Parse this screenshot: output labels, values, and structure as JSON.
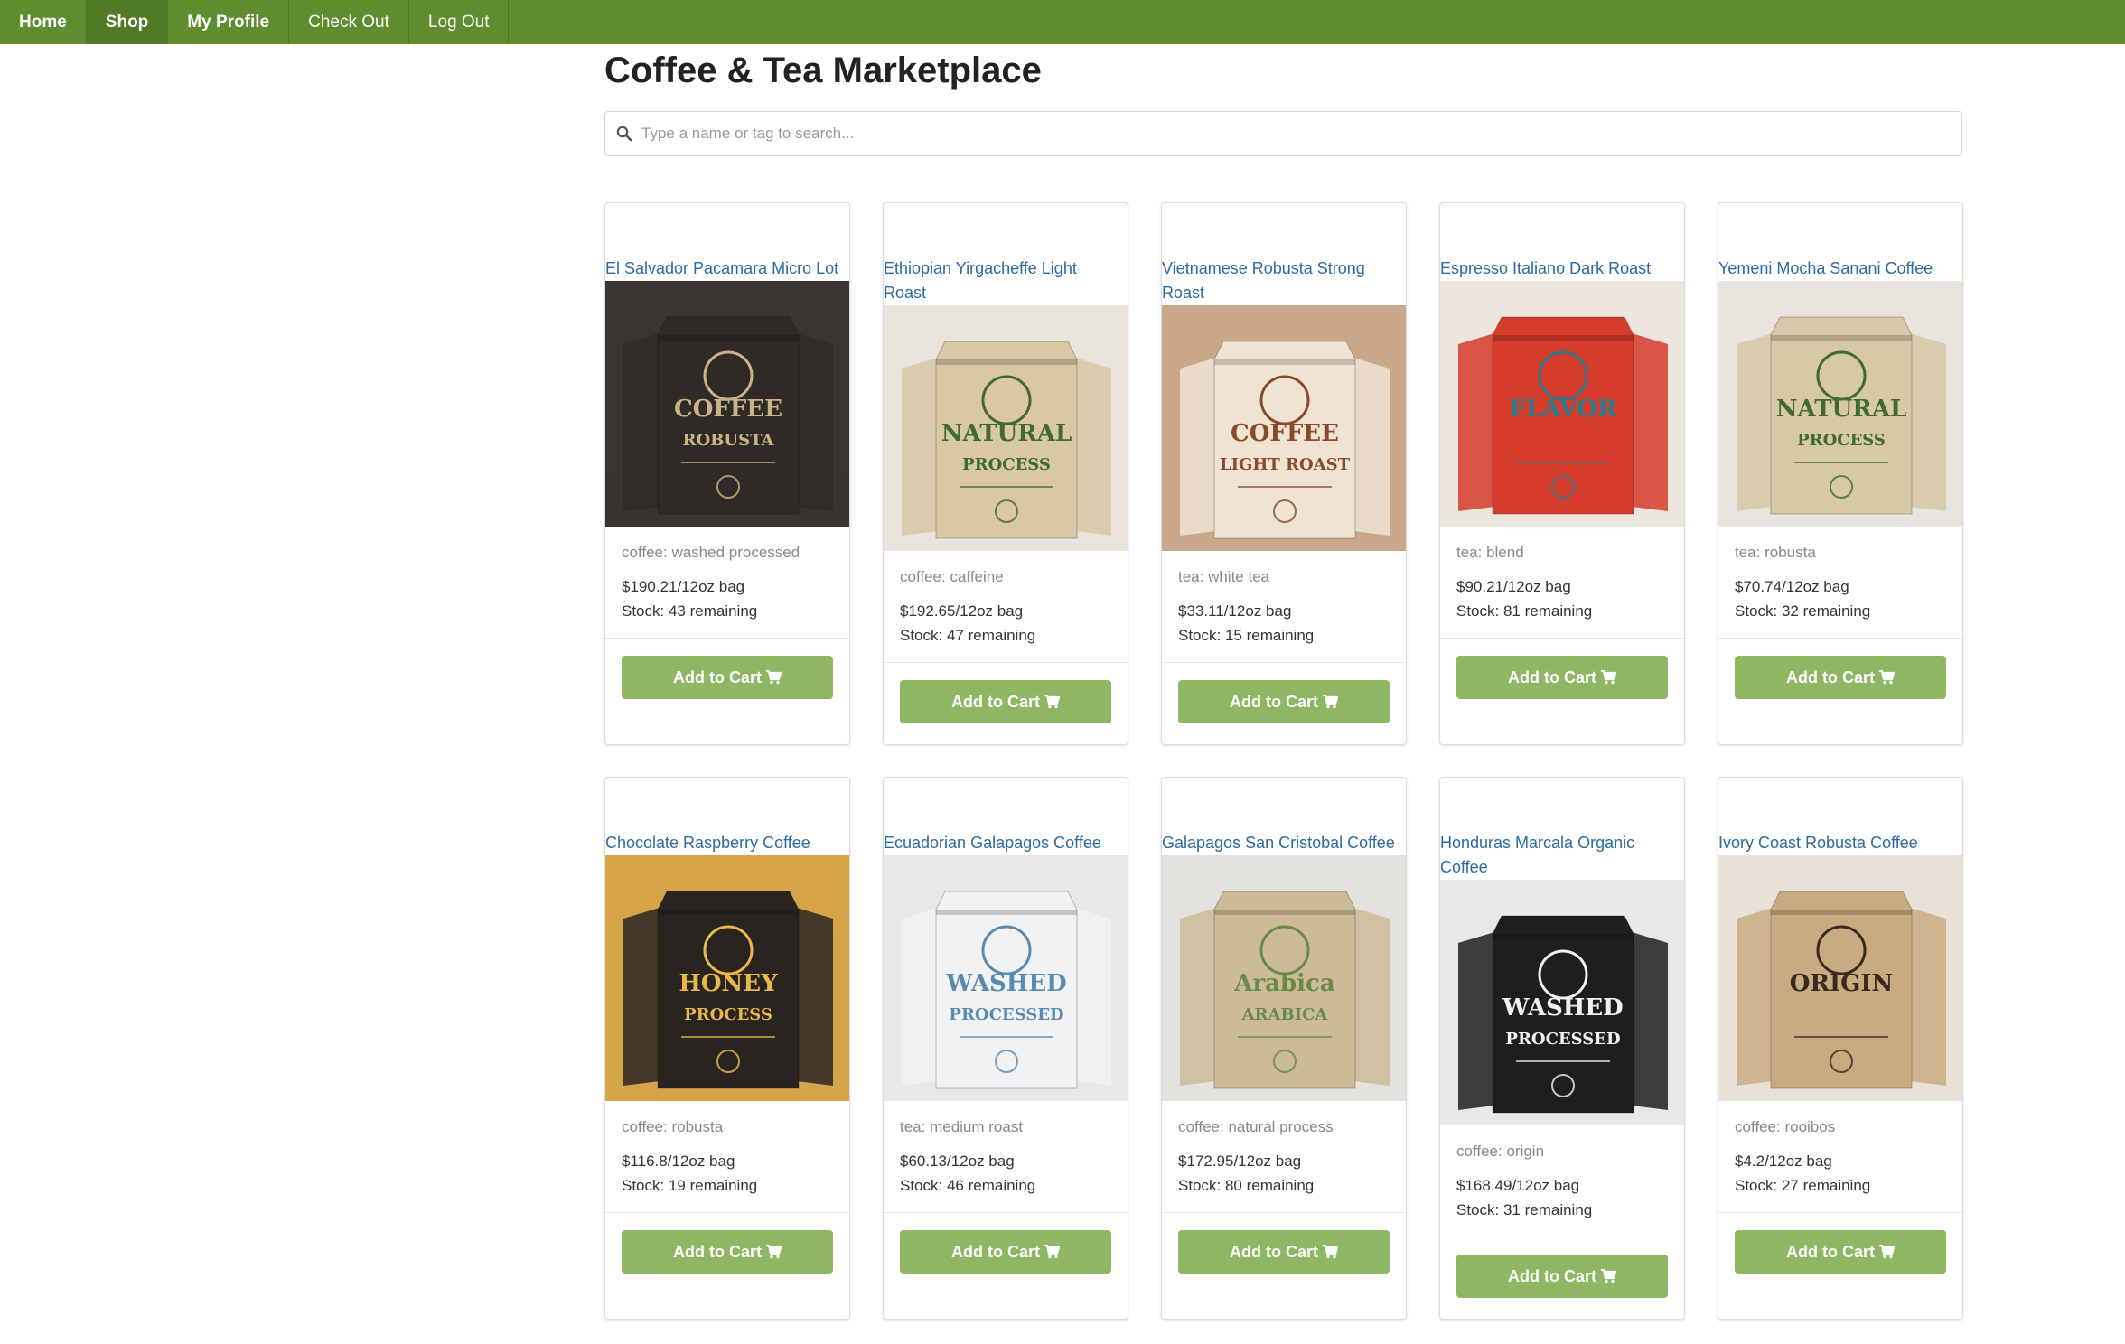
{
  "nav": [
    {
      "label": "Home",
      "name": "nav-home"
    },
    {
      "label": "Shop",
      "name": "nav-shop"
    },
    {
      "label": "My Profile",
      "name": "nav-my-profile"
    },
    {
      "label": "Check Out",
      "name": "nav-check-out"
    },
    {
      "label": "Log Out",
      "name": "nav-log-out"
    }
  ],
  "page": {
    "title": "Coffee & Tea Marketplace"
  },
  "search": {
    "placeholder": "Type a name or tag to search..."
  },
  "add_to_cart_label": "Add to Cart",
  "products": [
    {
      "title": "El Salvador Pacamara Micro Lot",
      "tag": "coffee: washed processed",
      "price": "$190.21/12oz bag",
      "stock": "Stock: 43 remaining",
      "art": {
        "bg": "#3a3530",
        "bag": "#2f2a26",
        "accent": "#c9b48a",
        "words": [
          "COFFEE",
          "ROBUSTA"
        ]
      }
    },
    {
      "title": "Ethiopian Yirgacheffe Light Roast",
      "tag": "coffee: caffeine",
      "price": "$192.65/12oz bag",
      "stock": "Stock: 47 remaining",
      "art": {
        "bg": "#e9e5dc",
        "bag": "#d9c7a6",
        "accent": "#3f6a35",
        "words": [
          "NATURAL",
          "PROCESS"
        ]
      }
    },
    {
      "title": "Vietnamese Robusta Strong Roast",
      "tag": "tea: white tea",
      "price": "$33.11/12oz bag",
      "stock": "Stock: 15 remaining",
      "art": {
        "bg": "#c9a88a",
        "bag": "#efe3d4",
        "accent": "#8a4a2a",
        "words": [
          "COFFEE",
          "LIGHT ROAST"
        ]
      }
    },
    {
      "title": "Espresso Italiano Dark Roast",
      "tag": "tea: blend",
      "price": "$90.21/12oz bag",
      "stock": "Stock: 81 remaining",
      "art": {
        "bg": "#ece6de",
        "bag": "#d63c2c",
        "accent": "#2a7a8a",
        "words": [
          "FLAVOR",
          ""
        ]
      }
    },
    {
      "title": "Yemeni Mocha Sanani Coffee",
      "tag": "tea: robusta",
      "price": "$70.74/12oz bag",
      "stock": "Stock: 32 remaining",
      "art": {
        "bg": "#e8e5de",
        "bag": "#d8c8a8",
        "accent": "#3f6a35",
        "words": [
          "NATURAL",
          "PROCESS"
        ]
      }
    },
    {
      "title": "Chocolate Raspberry Coffee",
      "tag": "coffee: robusta",
      "price": "$116.8/12oz bag",
      "stock": "Stock: 19 remaining",
      "art": {
        "bg": "#d6a54a",
        "bag": "#2a2420",
        "accent": "#e8b84a",
        "words": [
          "HONEY",
          "PROCESS"
        ]
      }
    },
    {
      "title": "Ecuadorian Galapagos Coffee",
      "tag": "tea: medium roast",
      "price": "$60.13/12oz bag",
      "stock": "Stock: 46 remaining",
      "art": {
        "bg": "#e6e8ea",
        "bag": "#f0f2f4",
        "accent": "#5a8ab0",
        "words": [
          "WASHED",
          "PROCESSED"
        ]
      }
    },
    {
      "title": "Galapagos San Cristobal Coffee",
      "tag": "coffee: natural process",
      "price": "$172.95/12oz bag",
      "stock": "Stock: 80 remaining",
      "art": {
        "bg": "#e4e2de",
        "bag": "#cdbb98",
        "accent": "#6a8a4a",
        "words": [
          "Arabica",
          "ARABICA"
        ]
      }
    },
    {
      "title": "Honduras Marcala Organic Coffee",
      "tag": "coffee: origin",
      "price": "$168.49/12oz bag",
      "stock": "Stock: 31 remaining",
      "art": {
        "bg": "#e8e8e8",
        "bag": "#1e1e1e",
        "accent": "#f0f0f0",
        "words": [
          "WASHED",
          "PROCESSED"
        ]
      }
    },
    {
      "title": "Ivory Coast Robusta Coffee",
      "tag": "coffee: rooibos",
      "price": "$4.2/12oz bag",
      "stock": "Stock: 27 remaining",
      "art": {
        "bg": "#e7e1d8",
        "bag": "#c9ab82",
        "accent": "#3a2a1e",
        "words": [
          "ORIGIN",
          ""
        ]
      }
    }
  ]
}
